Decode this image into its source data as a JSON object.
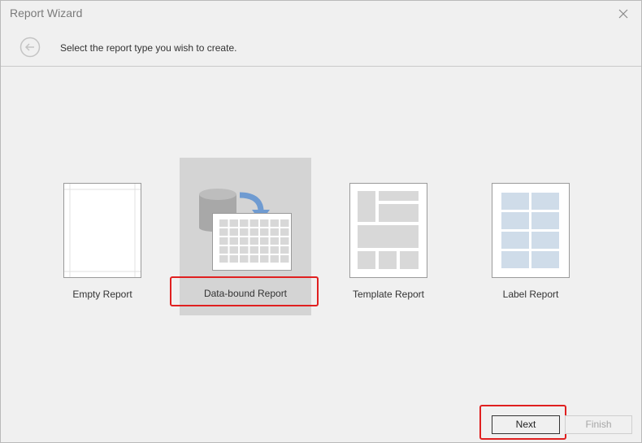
{
  "window": {
    "title": "Report Wizard",
    "close_icon": "close-icon"
  },
  "header": {
    "subtitle": "Select the report type you wish to create.",
    "back_icon": "back-arrow-icon"
  },
  "report_types": [
    {
      "label": "Empty Report",
      "icon": "empty-report-icon",
      "selected": false
    },
    {
      "label": "Data-bound Report",
      "icon": "data-bound-report-icon",
      "selected": true
    },
    {
      "label": "Template Report",
      "icon": "template-report-icon",
      "selected": false
    },
    {
      "label": "Label Report",
      "icon": "label-report-icon",
      "selected": false
    }
  ],
  "buttons": {
    "next": "Next",
    "finish": "Finish"
  },
  "colors": {
    "selection": "#d4d4d4",
    "highlight": "#e02020",
    "accent": "#6f9bd1",
    "label_cells": "#cfdce9"
  }
}
